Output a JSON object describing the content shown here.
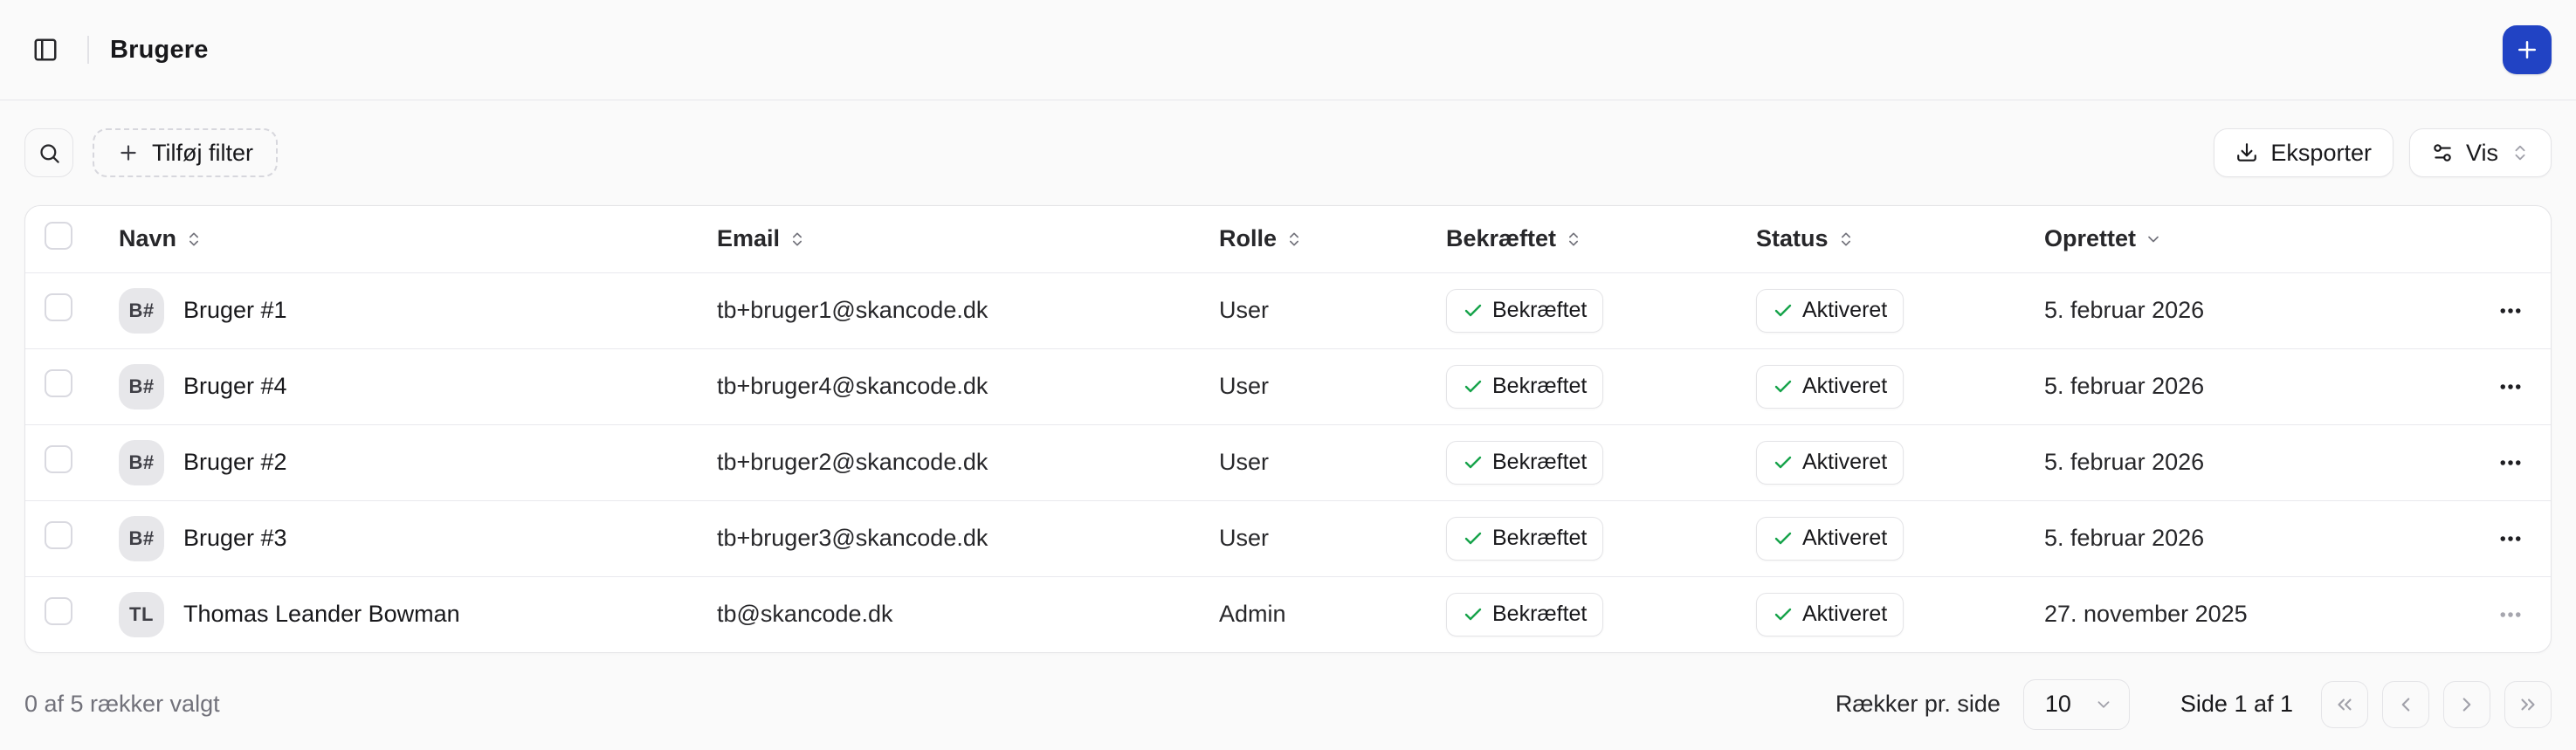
{
  "topbar": {
    "title": "Brugere"
  },
  "toolbar": {
    "add_filter_label": "Tilføj filter",
    "export_label": "Eksporter",
    "view_label": "Vis"
  },
  "table": {
    "columns": [
      {
        "label": "Navn",
        "sort": "sortable"
      },
      {
        "label": "Email",
        "sort": "sortable"
      },
      {
        "label": "Rolle",
        "sort": "sortable"
      },
      {
        "label": "Bekræftet",
        "sort": "sortable"
      },
      {
        "label": "Status",
        "sort": "sortable"
      },
      {
        "label": "Oprettet",
        "sort": "desc"
      }
    ],
    "rows": [
      {
        "initials": "B#",
        "name": "Bruger #1",
        "email": "tb+bruger1@skancode.dk",
        "role": "User",
        "confirmed": "Bekræftet",
        "status": "Aktiveret",
        "created": "5. februar 2026",
        "actions_muted": false
      },
      {
        "initials": "B#",
        "name": "Bruger #4",
        "email": "tb+bruger4@skancode.dk",
        "role": "User",
        "confirmed": "Bekræftet",
        "status": "Aktiveret",
        "created": "5. februar 2026",
        "actions_muted": false
      },
      {
        "initials": "B#",
        "name": "Bruger #2",
        "email": "tb+bruger2@skancode.dk",
        "role": "User",
        "confirmed": "Bekræftet",
        "status": "Aktiveret",
        "created": "5. februar 2026",
        "actions_muted": false
      },
      {
        "initials": "B#",
        "name": "Bruger #3",
        "email": "tb+bruger3@skancode.dk",
        "role": "User",
        "confirmed": "Bekræftet",
        "status": "Aktiveret",
        "created": "5. februar 2026",
        "actions_muted": false
      },
      {
        "initials": "TL",
        "name": "Thomas Leander Bowman",
        "email": "tb@skancode.dk",
        "role": "Admin",
        "confirmed": "Bekræftet",
        "status": "Aktiveret",
        "created": "27. november 2025",
        "actions_muted": true
      }
    ]
  },
  "footer": {
    "selection_text": "0 af 5 rækker valgt",
    "rows_per_page_label": "Rækker pr. side",
    "rows_per_page_value": "10",
    "page_info": "Side 1 af 1"
  },
  "icons": {
    "sidebar_toggle": "panel-left-icon",
    "add": "plus-icon",
    "search": "magnifier-icon",
    "export": "download-icon",
    "view": "sliders-icon",
    "sort": "chevrons-up-down-icon",
    "sorted_desc": "chevron-down-icon",
    "badge_check": "check-icon",
    "row_menu": "ellipsis-icon",
    "pager": [
      "chevrons-left-icon",
      "chevron-left-icon",
      "chevron-right-icon",
      "chevrons-right-icon"
    ]
  },
  "colors": {
    "primary": "#2143c4",
    "success_check": "#16a34a",
    "page_background": "#fafafa",
    "card_background": "#ffffff",
    "border": "#e4e4e7",
    "muted_text": "#71717a"
  }
}
